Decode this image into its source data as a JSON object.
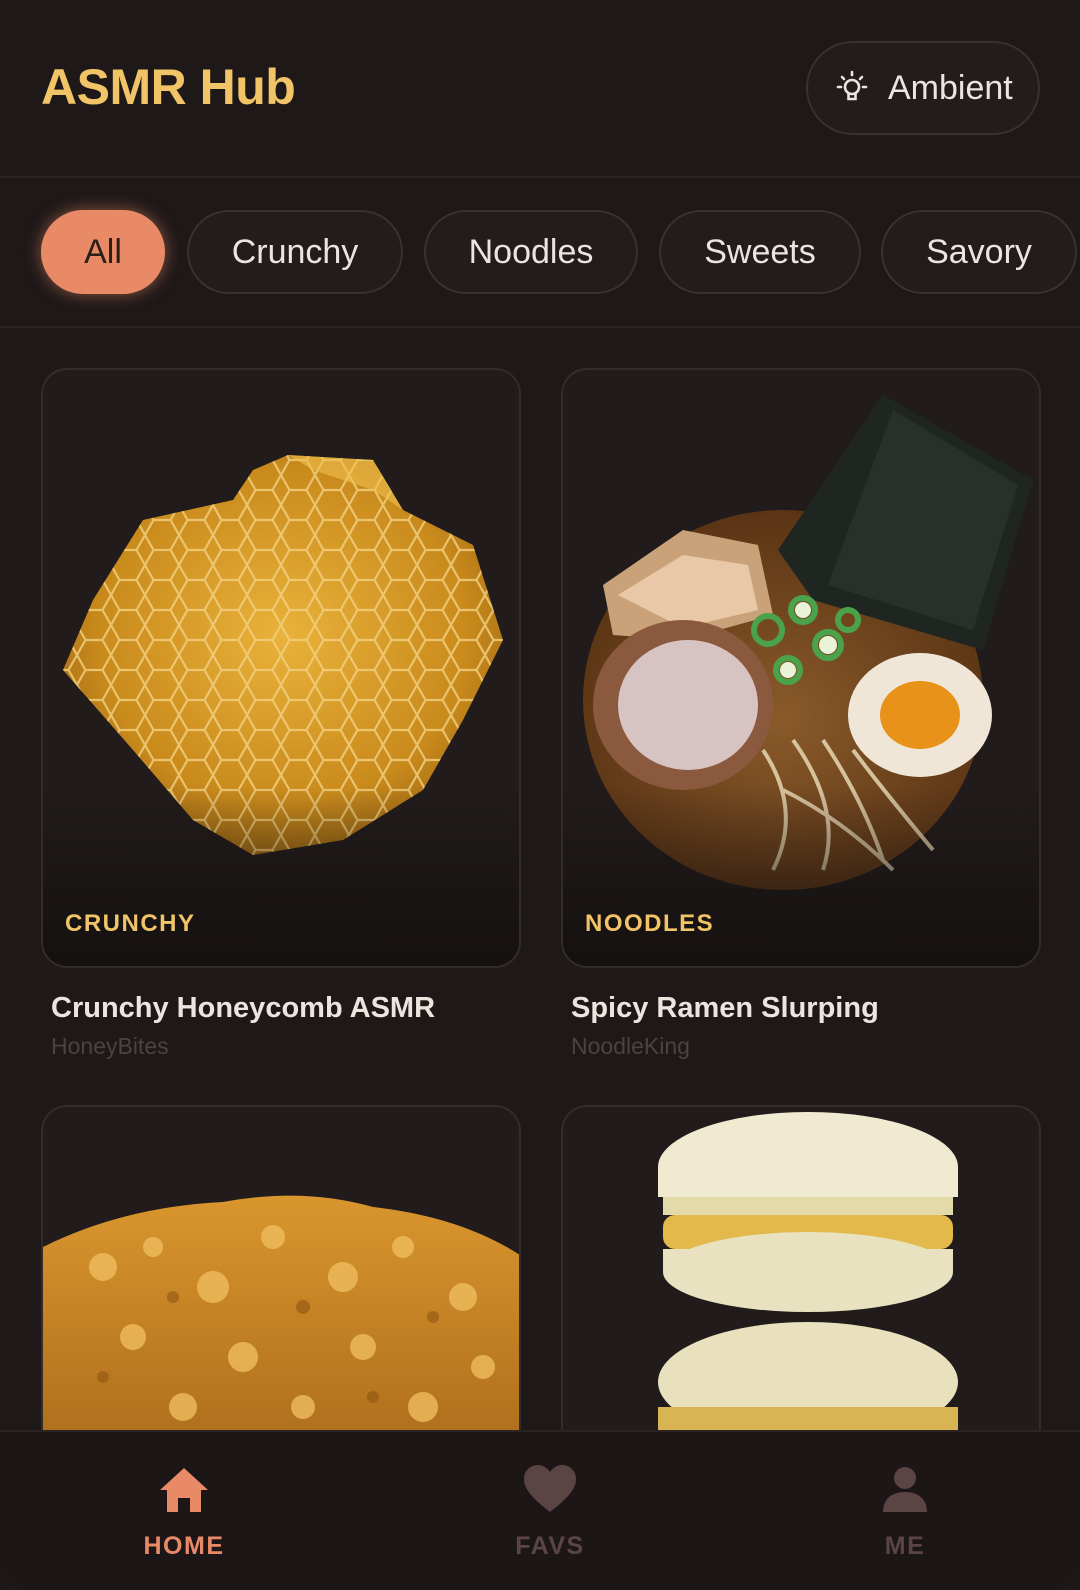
{
  "header": {
    "title": "ASMR Hub",
    "ambient_label": "Ambient"
  },
  "filters": [
    "All",
    "Crunchy",
    "Noodles",
    "Sweets",
    "Savory"
  ],
  "active_filter": "All",
  "cards": [
    {
      "tag": "CRUNCHY",
      "title": "Crunchy Honeycomb ASMR",
      "author": "HoneyBites",
      "image": "honeycomb"
    },
    {
      "tag": "NOODLES",
      "title": "Spicy Ramen Slurping",
      "author": "NoodleKing",
      "image": "ramen"
    },
    {
      "image": "fried-chicken"
    },
    {
      "image": "macarons"
    }
  ],
  "nav": {
    "home": "HOME",
    "favs": "FAVS",
    "me": "ME"
  },
  "colors": {
    "background": "#1e1818",
    "accent": "#e98a67",
    "title_gold": "#f1c467",
    "inactive_nav": "#5a4444"
  }
}
